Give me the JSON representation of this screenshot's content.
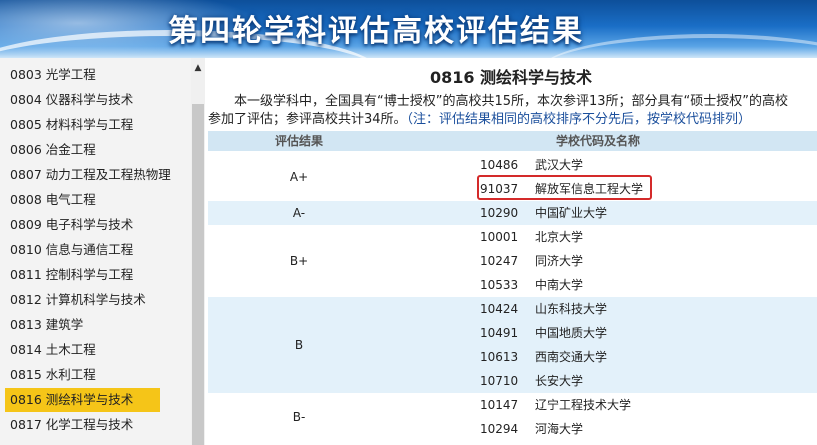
{
  "banner": {
    "title": "第四轮学科评估高校评估结果"
  },
  "sidebar": {
    "items": [
      {
        "label": "0803 光学工程"
      },
      {
        "label": "0804 仪器科学与技术"
      },
      {
        "label": "0805 材料科学与工程"
      },
      {
        "label": "0806 冶金工程"
      },
      {
        "label": "0807 动力工程及工程热物理"
      },
      {
        "label": "0808 电气工程"
      },
      {
        "label": "0809 电子科学与技术"
      },
      {
        "label": "0810 信息与通信工程"
      },
      {
        "label": "0811 控制科学与工程"
      },
      {
        "label": "0812 计算机科学与技术"
      },
      {
        "label": "0813 建筑学"
      },
      {
        "label": "0814 土木工程"
      },
      {
        "label": "0815 水利工程"
      },
      {
        "label": "0816 测绘科学与技术"
      },
      {
        "label": "0817 化学工程与技术"
      }
    ],
    "active_index": 13
  },
  "main": {
    "title": "0816 测绘科学与技术",
    "intro_line1": "本一级学科中，全国具有“博士授权”的高校共15所，本次参评13所；部分具有“硕士授权”的高校",
    "intro_line2": "参加了评估；参评高校共计34所。",
    "intro_note": "（注：评估结果相同的高校排序不分先后，按学校代码排列）",
    "table": {
      "col_grade": "评估结果",
      "col_school": "学校代码及名称",
      "groups": [
        {
          "grade": "A+",
          "schools": [
            {
              "code": "10486",
              "name": "武汉大学"
            },
            {
              "code": "91037",
              "name": "解放军信息工程大学"
            }
          ]
        },
        {
          "grade": "A-",
          "schools": [
            {
              "code": "10290",
              "name": "中国矿业大学"
            }
          ]
        },
        {
          "grade": "B+",
          "schools": [
            {
              "code": "10001",
              "name": "北京大学"
            },
            {
              "code": "10247",
              "name": "同济大学"
            },
            {
              "code": "10533",
              "name": "中南大学"
            }
          ]
        },
        {
          "grade": "B",
          "schools": [
            {
              "code": "10424",
              "name": "山东科技大学"
            },
            {
              "code": "10491",
              "name": "中国地质大学"
            },
            {
              "code": "10613",
              "name": "西南交通大学"
            },
            {
              "code": "10710",
              "name": "长安大学"
            }
          ]
        },
        {
          "grade": "B-",
          "schools": [
            {
              "code": "10147",
              "name": "辽宁工程技术大学"
            },
            {
              "code": "10294",
              "name": "河海大学"
            }
          ]
        }
      ]
    }
  },
  "colors": {
    "active_item": "#f5c518",
    "table_header": "#d2e6f3",
    "row_shade": "#e3f1fa",
    "highlight_border": "#d42a2a",
    "note_text": "#1b4f9c"
  }
}
